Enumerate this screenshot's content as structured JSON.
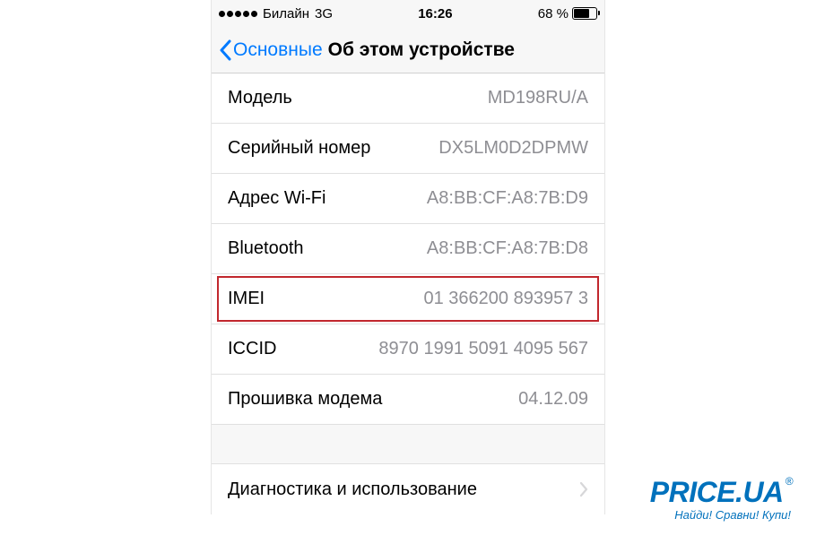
{
  "statusBar": {
    "carrier": "Билайн",
    "network": "3G",
    "time": "16:26",
    "batteryPercent": "68 %"
  },
  "nav": {
    "backLabel": "Основные",
    "title": "Об этом устройстве"
  },
  "rows": [
    {
      "label": "Модель",
      "value": "MD198RU/A",
      "highlighted": false
    },
    {
      "label": "Серийный номер",
      "value": "DX5LM0D2DPMW",
      "highlighted": false
    },
    {
      "label": "Адрес Wi-Fi",
      "value": "A8:BB:CF:A8:7B:D9",
      "highlighted": false
    },
    {
      "label": "Bluetooth",
      "value": "A8:BB:CF:A8:7B:D8",
      "highlighted": false
    },
    {
      "label": "IMEI",
      "value": "01 366200 893957 3",
      "highlighted": true
    },
    {
      "label": "ICCID",
      "value": "8970 1991 5091 4095 567",
      "highlighted": false
    },
    {
      "label": "Прошивка модема",
      "value": "04.12.09",
      "highlighted": false
    }
  ],
  "diagnostics": {
    "label": "Диагностика и использование"
  },
  "watermark": {
    "logo": "PRICE.UA",
    "reg": "®",
    "tagline": "Найди! Сравни! Купи!"
  }
}
